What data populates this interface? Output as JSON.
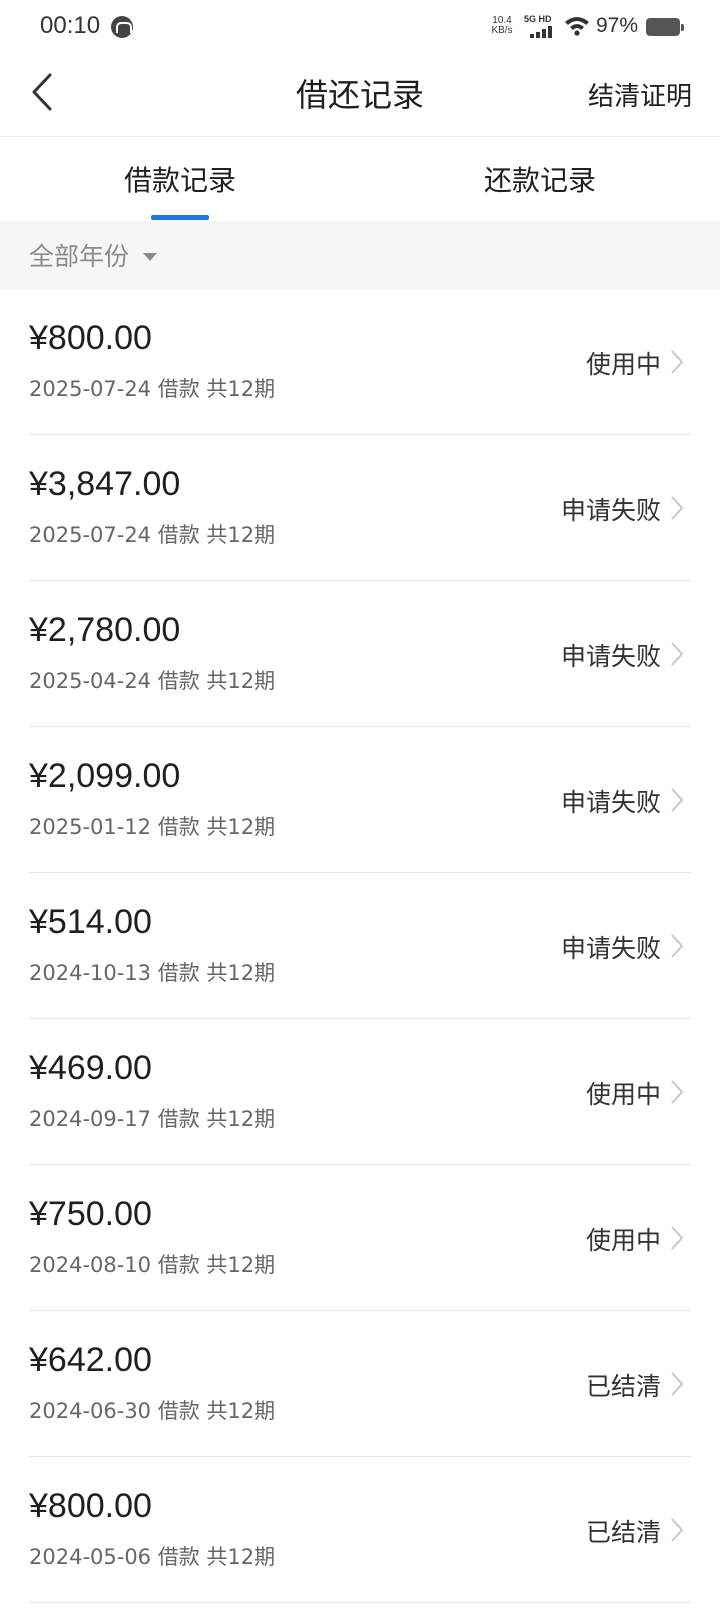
{
  "status_bar": {
    "time": "00:10",
    "speed_value": "10.4",
    "speed_unit": "KB/s",
    "network": "5G HD",
    "battery_percent": "97%"
  },
  "header": {
    "title": "借还记录",
    "action": "结清证明",
    "back_icon": "chevron-left-icon"
  },
  "tabs": [
    {
      "label": "借款记录",
      "active": true
    },
    {
      "label": "还款记录",
      "active": false
    }
  ],
  "filter": {
    "label": "全部年份"
  },
  "accent_color": "#1677e5",
  "records": [
    {
      "amount": "¥800.00",
      "meta": "2025-07-24 借款 共12期",
      "status": "使用中"
    },
    {
      "amount": "¥3,847.00",
      "meta": "2025-07-24 借款 共12期",
      "status": "申请失败"
    },
    {
      "amount": "¥2,780.00",
      "meta": "2025-04-24 借款 共12期",
      "status": "申请失败"
    },
    {
      "amount": "¥2,099.00",
      "meta": "2025-01-12 借款 共12期",
      "status": "申请失败"
    },
    {
      "amount": "¥514.00",
      "meta": "2024-10-13 借款 共12期",
      "status": "申请失败"
    },
    {
      "amount": "¥469.00",
      "meta": "2024-09-17 借款 共12期",
      "status": "使用中"
    },
    {
      "amount": "¥750.00",
      "meta": "2024-08-10 借款 共12期",
      "status": "使用中"
    },
    {
      "amount": "¥642.00",
      "meta": "2024-06-30 借款 共12期",
      "status": "已结清"
    },
    {
      "amount": "¥800.00",
      "meta": "2024-05-06 借款 共12期",
      "status": "已结清"
    }
  ]
}
